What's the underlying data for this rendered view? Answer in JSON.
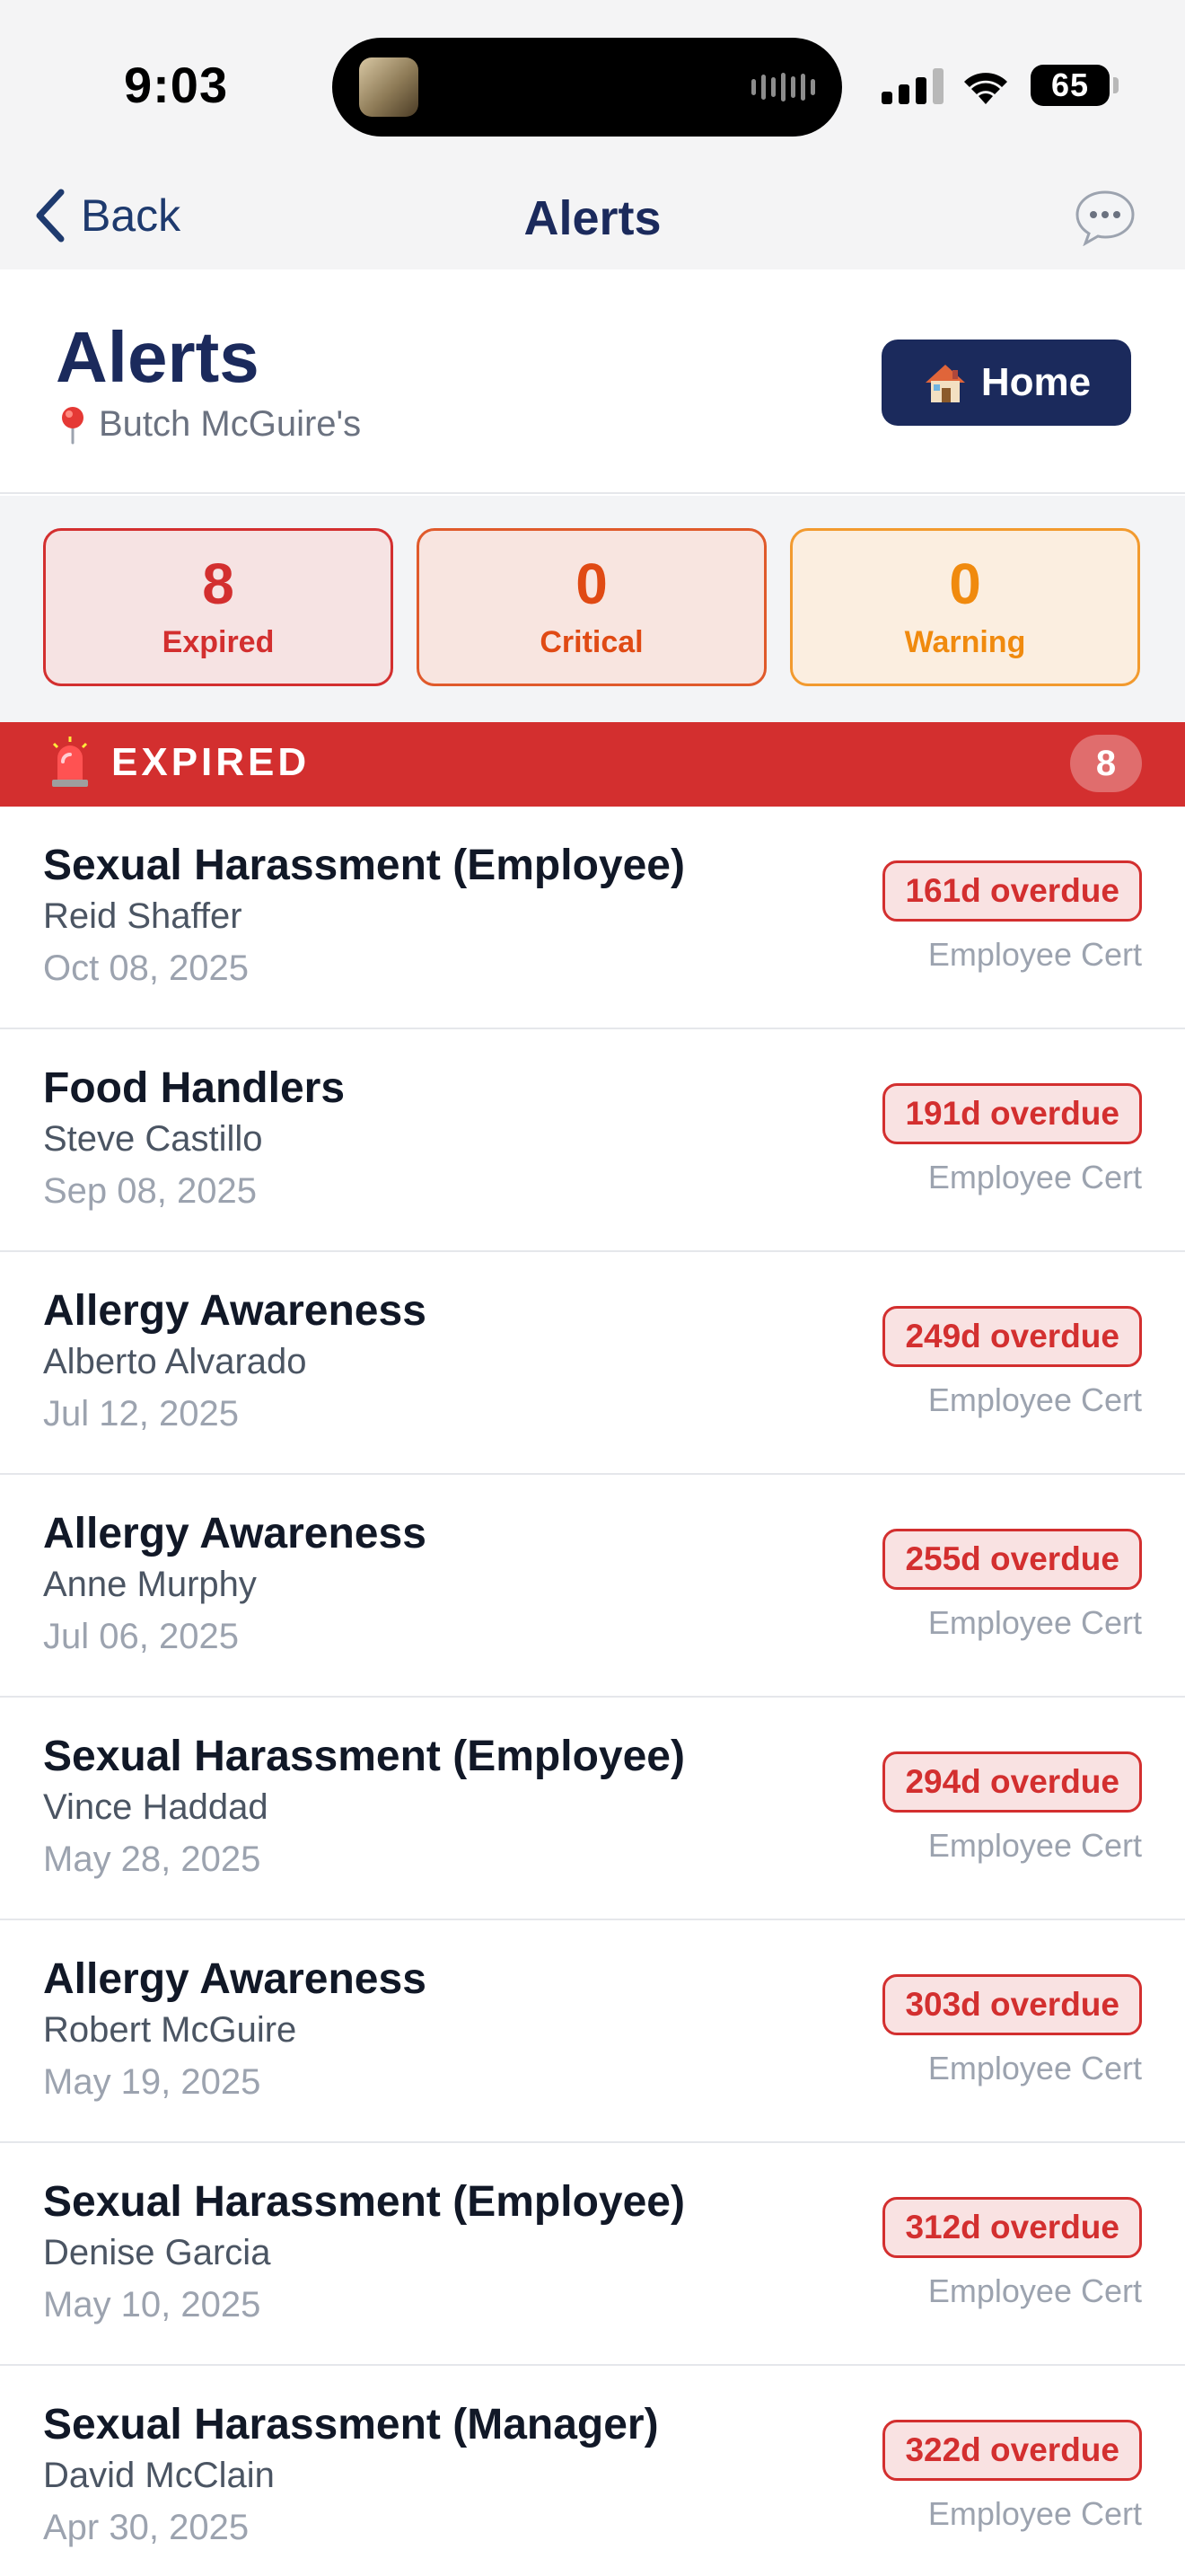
{
  "status_bar": {
    "time": "9:03",
    "battery": "65"
  },
  "nav": {
    "back_label": "Back",
    "title": "Alerts"
  },
  "header": {
    "title": "Alerts",
    "location": "Butch McGuire's",
    "home_label": "Home"
  },
  "summary": [
    {
      "count": "8",
      "label": "Expired"
    },
    {
      "count": "0",
      "label": "Critical"
    },
    {
      "count": "0",
      "label": "Warning"
    }
  ],
  "section": {
    "title": "EXPIRED",
    "count": "8"
  },
  "alerts": [
    {
      "title": "Sexual Harassment (Employee)",
      "person": "Reid Shaffer",
      "date": "Oct 08, 2025",
      "overdue": "161d overdue",
      "type": "Employee Cert"
    },
    {
      "title": "Food Handlers",
      "person": "Steve Castillo",
      "date": "Sep 08, 2025",
      "overdue": "191d overdue",
      "type": "Employee Cert"
    },
    {
      "title": "Allergy Awareness",
      "person": "Alberto Alvarado",
      "date": "Jul 12, 2025",
      "overdue": "249d overdue",
      "type": "Employee Cert"
    },
    {
      "title": "Allergy Awareness",
      "person": "Anne Murphy",
      "date": "Jul 06, 2025",
      "overdue": "255d overdue",
      "type": "Employee Cert"
    },
    {
      "title": "Sexual Harassment (Employee)",
      "person": "Vince Haddad",
      "date": "May 28, 2025",
      "overdue": "294d overdue",
      "type": "Employee Cert"
    },
    {
      "title": "Allergy Awareness",
      "person": "Robert McGuire",
      "date": "May 19, 2025",
      "overdue": "303d overdue",
      "type": "Employee Cert"
    },
    {
      "title": "Sexual Harassment (Employee)",
      "person": "Denise Garcia",
      "date": "May 10, 2025",
      "overdue": "312d overdue",
      "type": "Employee Cert"
    },
    {
      "title": "Sexual Harassment (Manager)",
      "person": "David McClain",
      "date": "Apr 30, 2025",
      "overdue": "322d overdue",
      "type": "Employee Cert"
    }
  ]
}
